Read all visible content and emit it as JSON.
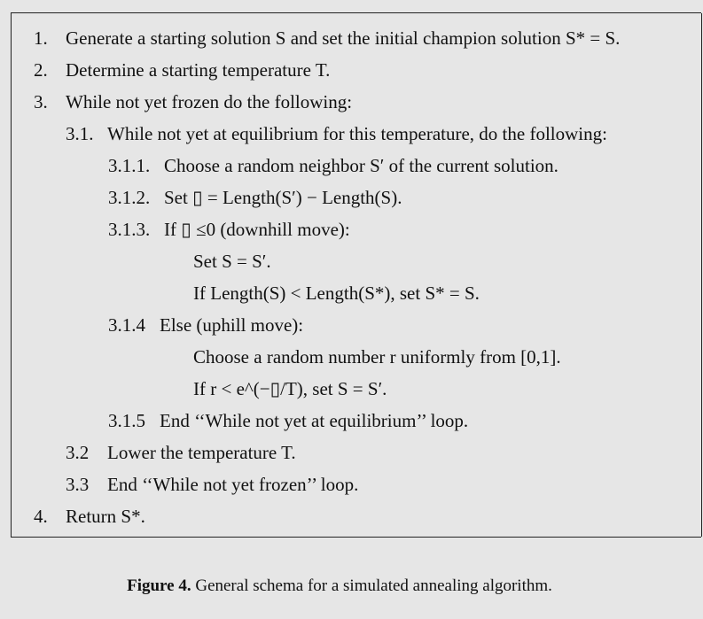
{
  "lines": [
    {
      "num": "1.",
      "text": "Generate a starting solution S and set the initial champion solution S* = S."
    },
    {
      "num": "2.",
      "text": "Determine a starting temperature T."
    },
    {
      "num": "3.",
      "text": "While not yet frozen do the following:"
    },
    {
      "num": "3.1.",
      "text": "While not yet at equilibrium for this temperature, do the following:"
    },
    {
      "num": "3.1.1.",
      "text": "Choose a random neighbor S′ of the current solution."
    },
    {
      "num": "3.1.2.",
      "text": "Set ▯ = Length(S′) − Length(S)."
    },
    {
      "num": "3.1.3.",
      "text": "If ▯ ≤0 (downhill move):"
    },
    {
      "num": "",
      "text": "Set S = S′."
    },
    {
      "num": "",
      "text": "If Length(S) < Length(S*), set S* = S."
    },
    {
      "num": "3.1.4",
      "text": "Else (uphill move):"
    },
    {
      "num": "",
      "text": "Choose a random number r uniformly from [0,1]."
    },
    {
      "num": "",
      "text": "If r < e^(−▯/T), set S = S′."
    },
    {
      "num": "3.1.5",
      "text": "End ‘‘While not yet at equilibrium’’ loop."
    },
    {
      "num": "3.2",
      "text": "Lower the temperature T."
    },
    {
      "num": "3.3",
      "text": "End ‘‘While not yet frozen’’ loop."
    },
    {
      "num": "4.",
      "text": "Return S*."
    }
  ],
  "caption": {
    "label": "Figure 4.",
    "text": "General schema for a simulated annealing algorithm."
  }
}
